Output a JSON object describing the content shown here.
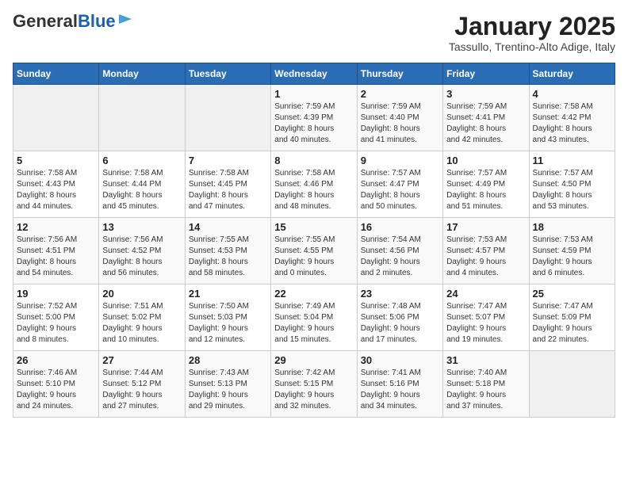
{
  "header": {
    "logo_line1": "General",
    "logo_line2": "Blue",
    "month": "January 2025",
    "location": "Tassullo, Trentino-Alto Adige, Italy"
  },
  "weekdays": [
    "Sunday",
    "Monday",
    "Tuesday",
    "Wednesday",
    "Thursday",
    "Friday",
    "Saturday"
  ],
  "weeks": [
    [
      {
        "day": "",
        "info": ""
      },
      {
        "day": "",
        "info": ""
      },
      {
        "day": "",
        "info": ""
      },
      {
        "day": "1",
        "info": "Sunrise: 7:59 AM\nSunset: 4:39 PM\nDaylight: 8 hours\nand 40 minutes."
      },
      {
        "day": "2",
        "info": "Sunrise: 7:59 AM\nSunset: 4:40 PM\nDaylight: 8 hours\nand 41 minutes."
      },
      {
        "day": "3",
        "info": "Sunrise: 7:59 AM\nSunset: 4:41 PM\nDaylight: 8 hours\nand 42 minutes."
      },
      {
        "day": "4",
        "info": "Sunrise: 7:58 AM\nSunset: 4:42 PM\nDaylight: 8 hours\nand 43 minutes."
      }
    ],
    [
      {
        "day": "5",
        "info": "Sunrise: 7:58 AM\nSunset: 4:43 PM\nDaylight: 8 hours\nand 44 minutes."
      },
      {
        "day": "6",
        "info": "Sunrise: 7:58 AM\nSunset: 4:44 PM\nDaylight: 8 hours\nand 45 minutes."
      },
      {
        "day": "7",
        "info": "Sunrise: 7:58 AM\nSunset: 4:45 PM\nDaylight: 8 hours\nand 47 minutes."
      },
      {
        "day": "8",
        "info": "Sunrise: 7:58 AM\nSunset: 4:46 PM\nDaylight: 8 hours\nand 48 minutes."
      },
      {
        "day": "9",
        "info": "Sunrise: 7:57 AM\nSunset: 4:47 PM\nDaylight: 8 hours\nand 50 minutes."
      },
      {
        "day": "10",
        "info": "Sunrise: 7:57 AM\nSunset: 4:49 PM\nDaylight: 8 hours\nand 51 minutes."
      },
      {
        "day": "11",
        "info": "Sunrise: 7:57 AM\nSunset: 4:50 PM\nDaylight: 8 hours\nand 53 minutes."
      }
    ],
    [
      {
        "day": "12",
        "info": "Sunrise: 7:56 AM\nSunset: 4:51 PM\nDaylight: 8 hours\nand 54 minutes."
      },
      {
        "day": "13",
        "info": "Sunrise: 7:56 AM\nSunset: 4:52 PM\nDaylight: 8 hours\nand 56 minutes."
      },
      {
        "day": "14",
        "info": "Sunrise: 7:55 AM\nSunset: 4:53 PM\nDaylight: 8 hours\nand 58 minutes."
      },
      {
        "day": "15",
        "info": "Sunrise: 7:55 AM\nSunset: 4:55 PM\nDaylight: 9 hours\nand 0 minutes."
      },
      {
        "day": "16",
        "info": "Sunrise: 7:54 AM\nSunset: 4:56 PM\nDaylight: 9 hours\nand 2 minutes."
      },
      {
        "day": "17",
        "info": "Sunrise: 7:53 AM\nSunset: 4:57 PM\nDaylight: 9 hours\nand 4 minutes."
      },
      {
        "day": "18",
        "info": "Sunrise: 7:53 AM\nSunset: 4:59 PM\nDaylight: 9 hours\nand 6 minutes."
      }
    ],
    [
      {
        "day": "19",
        "info": "Sunrise: 7:52 AM\nSunset: 5:00 PM\nDaylight: 9 hours\nand 8 minutes."
      },
      {
        "day": "20",
        "info": "Sunrise: 7:51 AM\nSunset: 5:02 PM\nDaylight: 9 hours\nand 10 minutes."
      },
      {
        "day": "21",
        "info": "Sunrise: 7:50 AM\nSunset: 5:03 PM\nDaylight: 9 hours\nand 12 minutes."
      },
      {
        "day": "22",
        "info": "Sunrise: 7:49 AM\nSunset: 5:04 PM\nDaylight: 9 hours\nand 15 minutes."
      },
      {
        "day": "23",
        "info": "Sunrise: 7:48 AM\nSunset: 5:06 PM\nDaylight: 9 hours\nand 17 minutes."
      },
      {
        "day": "24",
        "info": "Sunrise: 7:47 AM\nSunset: 5:07 PM\nDaylight: 9 hours\nand 19 minutes."
      },
      {
        "day": "25",
        "info": "Sunrise: 7:47 AM\nSunset: 5:09 PM\nDaylight: 9 hours\nand 22 minutes."
      }
    ],
    [
      {
        "day": "26",
        "info": "Sunrise: 7:46 AM\nSunset: 5:10 PM\nDaylight: 9 hours\nand 24 minutes."
      },
      {
        "day": "27",
        "info": "Sunrise: 7:44 AM\nSunset: 5:12 PM\nDaylight: 9 hours\nand 27 minutes."
      },
      {
        "day": "28",
        "info": "Sunrise: 7:43 AM\nSunset: 5:13 PM\nDaylight: 9 hours\nand 29 minutes."
      },
      {
        "day": "29",
        "info": "Sunrise: 7:42 AM\nSunset: 5:15 PM\nDaylight: 9 hours\nand 32 minutes."
      },
      {
        "day": "30",
        "info": "Sunrise: 7:41 AM\nSunset: 5:16 PM\nDaylight: 9 hours\nand 34 minutes."
      },
      {
        "day": "31",
        "info": "Sunrise: 7:40 AM\nSunset: 5:18 PM\nDaylight: 9 hours\nand 37 minutes."
      },
      {
        "day": "",
        "info": ""
      }
    ]
  ]
}
